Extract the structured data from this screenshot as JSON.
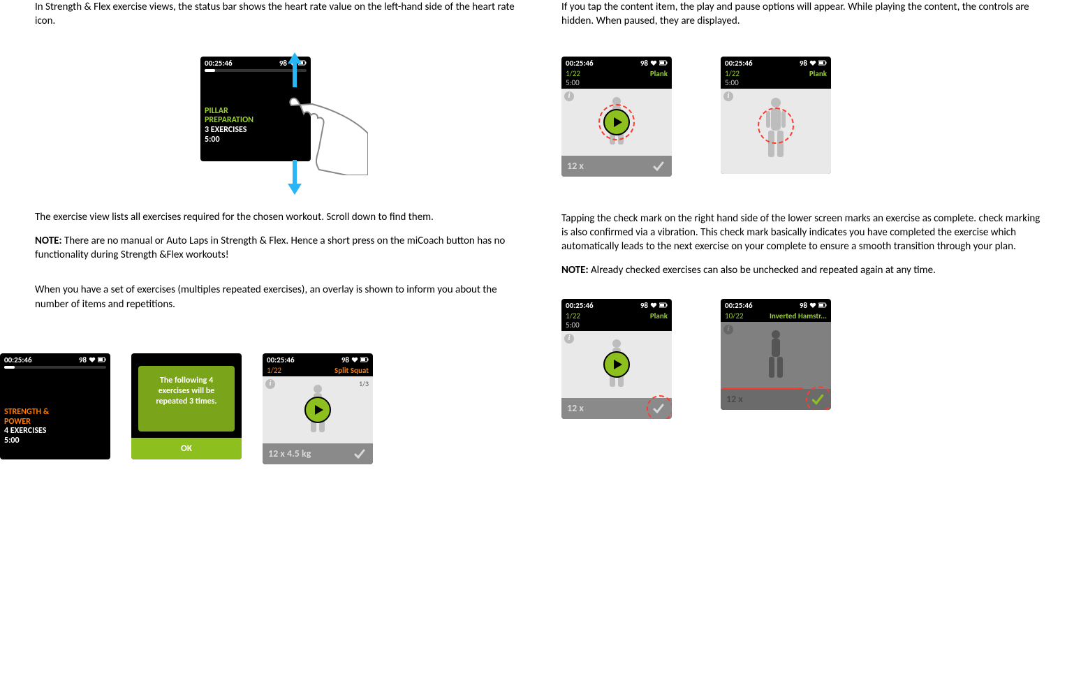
{
  "left": {
    "p1": "In Strength & Flex exercise views, the status bar shows the heart rate value on the left-hand side of the heart rate icon.",
    "p2": "The exercise view lists all exercises required for the chosen workout. Scroll down to find them.",
    "note_label": "NOTE:",
    "note_text": " There are no manual or Auto Laps in Strength & Flex. Hence a  short press on the miCoach button has no functionality during Strength &Flex workouts!",
    "p3": "When you have a set of exercises (multiples repeated exercises), an overlay is shown to inform you about the number of items and repetitions."
  },
  "right": {
    "p1": "If you tap the content item, the play and pause options will appear. While playing the content, the controls are hidden. When paused, they are displayed.",
    "p2": "Tapping the check mark on the right hand side of the lower screen marks an exercise as complete.  check marking is also confirmed via a  vibration. This check mark basically indicates you have completed the exercise which automatically leads to the next exercise on your complete to ensure a smooth transition through your plan.",
    "note_label": "NOTE:",
    "note_text": " Already checked exercises can also be unchecked and repeated again at any time."
  },
  "status": {
    "time": "00:25:46",
    "hr": "98"
  },
  "dev_scroll": {
    "l1": "PILLAR",
    "l2": "PREPARATION",
    "l3": "3 EXERCISES",
    "l4": "5:00"
  },
  "dev_strength": {
    "l1": "STRENGTH &",
    "l2": "POWER",
    "l3": "4 EXERCISES",
    "l4": "5:00"
  },
  "overlay": {
    "msg": "The following 4 exercises will be repeated 3 times.",
    "ok": "OK"
  },
  "dev_split": {
    "idx": "1/22",
    "name": "Split Squat",
    "count": "1/3",
    "footer": "12 x 4.5 kg"
  },
  "dev_plank": {
    "idx": "1/22",
    "name": "Plank",
    "time": "5:00",
    "footer": "12 x"
  },
  "dev_inverted": {
    "idx": "10/22",
    "name": "Inverted Hamstr...",
    "footer": "12 x"
  },
  "icons": {
    "info": "i"
  }
}
